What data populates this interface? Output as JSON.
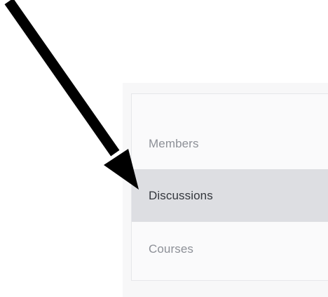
{
  "nav": {
    "items": [
      {
        "label": "Members",
        "active": false
      },
      {
        "label": "Discussions",
        "active": true
      },
      {
        "label": "Courses",
        "active": false
      }
    ]
  },
  "annotation": {
    "icon": "arrow-annotation-icon",
    "color": "#000000"
  },
  "colors": {
    "active_background": "#dddee2",
    "inactive_text": "#8d9097",
    "active_text": "#33363c"
  }
}
